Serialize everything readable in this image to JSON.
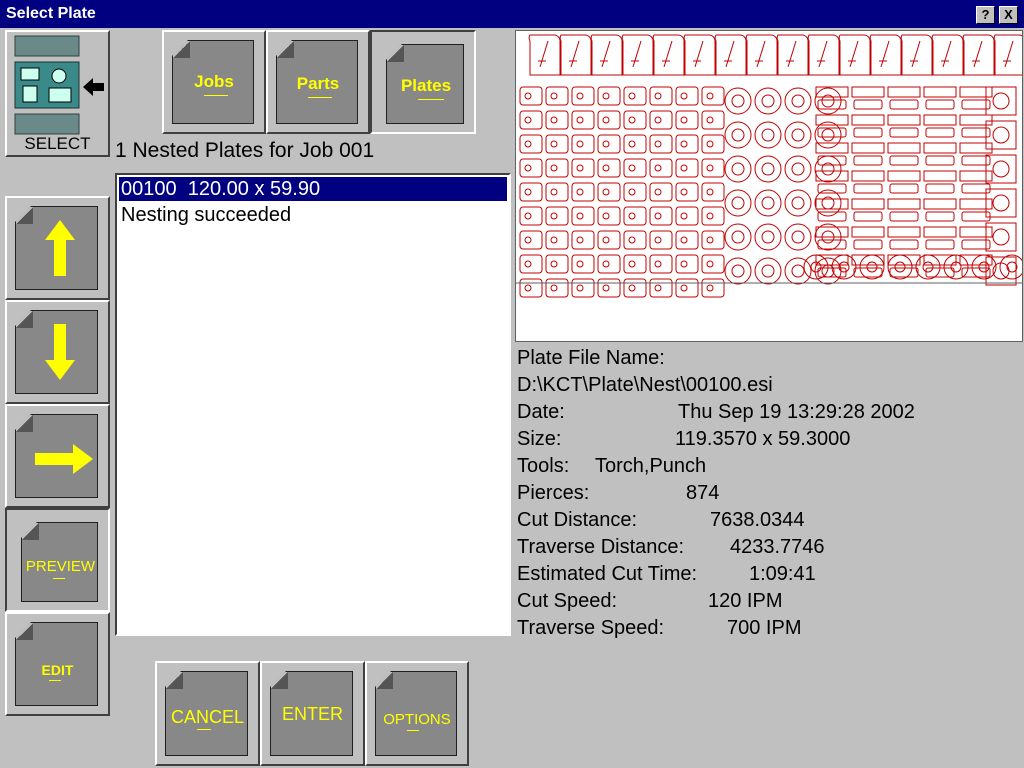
{
  "window": {
    "title": "Select Plate",
    "help_label": "?",
    "close_label": "X"
  },
  "select_tool": {
    "label": "SELECT"
  },
  "tabs": [
    {
      "label": "Jobs"
    },
    {
      "label": "Parts"
    },
    {
      "label": "Plates"
    }
  ],
  "job_heading": "1 Nested Plates for Job 001",
  "plate_list": [
    {
      "text": "00100  120.00 x 59.90",
      "selected": true
    },
    {
      "text": "Nesting succeeded",
      "selected": false
    }
  ],
  "side_buttons": {
    "up": "up-arrow-icon",
    "down": "down-arrow-icon",
    "right": "right-arrow-icon",
    "preview_label": "PREVIEW",
    "edit_label": "EDIT"
  },
  "bottom_buttons": {
    "cancel_label": "CANCEL",
    "enter_label": "ENTER",
    "options_label": "OPTIONS"
  },
  "plate_info": {
    "file_name_label": "Plate File Name:",
    "file_path": "D:\\KCT\\Plate\\Nest\\00100.esi",
    "date_label": "Date:",
    "date_value": "Thu Sep 19 13:29:28 2002",
    "size_label": "Size:",
    "size_value": "119.3570 x 59.3000",
    "tools_label": "Tools:",
    "tools_value": "Torch,Punch",
    "pierces_label": "Pierces:",
    "pierces_value": "874",
    "cut_distance_label": "Cut Distance:",
    "cut_distance_value": "7638.0344",
    "traverse_distance_label": "Traverse Distance:",
    "traverse_distance_value": "4233.7746",
    "est_cut_time_label": "Estimated Cut Time:",
    "est_cut_time_value": "1:09:41",
    "cut_speed_label": "Cut Speed:",
    "cut_speed_value": "120 IPM",
    "traverse_speed_label": "Traverse Speed:",
    "traverse_speed_value": "700 IPM"
  },
  "colors": {
    "title_bg": "#000080",
    "key_label": "#ffff00",
    "nest_lines": "#c00000",
    "panel": "#c0c0c0"
  }
}
